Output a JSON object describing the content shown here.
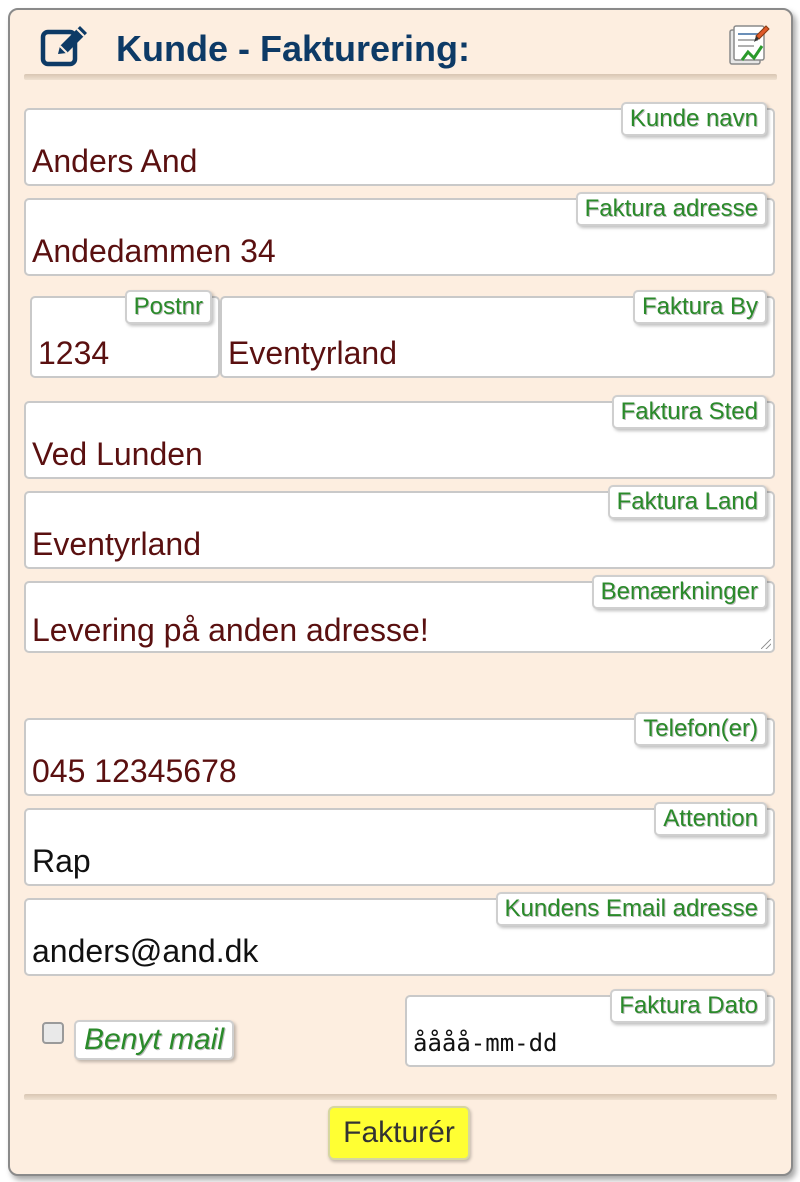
{
  "header": {
    "title": "Kunde - Fakturering:",
    "left_icon": "edit-icon",
    "right_icon": "report-icon"
  },
  "fields": {
    "kunde_navn": {
      "label": "Kunde navn",
      "value": "Anders And"
    },
    "adresse": {
      "label": "Faktura adresse",
      "value": "Andedammen 34"
    },
    "postnr": {
      "label": "Postnr",
      "value": "1234"
    },
    "by": {
      "label": "Faktura By",
      "value": "Eventyrland"
    },
    "sted": {
      "label": "Faktura Sted",
      "value": "Ved Lunden"
    },
    "land": {
      "label": "Faktura Land",
      "value": "Eventyrland"
    },
    "bemaerkninger": {
      "label": "Bemærkninger",
      "value": "Levering på anden adresse!"
    },
    "telefon": {
      "label": "Telefon(er)",
      "value": "045 12345678"
    },
    "attention": {
      "label": "Attention",
      "value": "Rap"
    },
    "email": {
      "label": "Kundens Email adresse",
      "value": "anders@and.dk"
    },
    "dato": {
      "label": "Faktura Dato",
      "placeholder": "åååå-mm-dd"
    }
  },
  "use_mail": {
    "label": "Benyt mail",
    "checked": false
  },
  "submit_label": "Fakturér",
  "colors": {
    "panel_bg": "#fdeee0",
    "title": "#0d3a66",
    "value_text": "#5a1010",
    "label_text": "#2a8a2a",
    "submit_bg": "#ffff33"
  }
}
